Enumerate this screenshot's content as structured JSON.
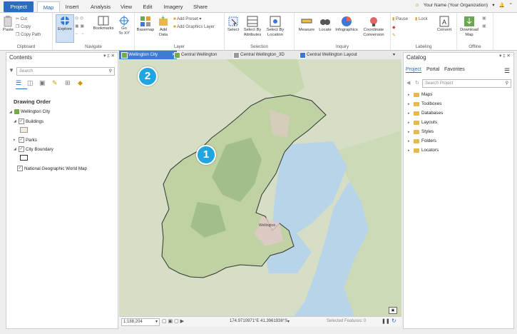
{
  "ribbon_tabs": [
    "Project",
    "Map",
    "Insert",
    "Analysis",
    "View",
    "Edit",
    "Imagery",
    "Share"
  ],
  "user": {
    "name": "Your Name (Your Organization)"
  },
  "clipboard": {
    "paste": "Paste",
    "cut": "Cut",
    "copy": "Copy",
    "copy_path": "Copy Path",
    "label": "Clipboard"
  },
  "navigate": {
    "explore": "Explore",
    "bookmarks": "Bookmarks",
    "go_to_xy": "Go To XY",
    "go": "Go",
    "to_xy": "To XY",
    "label": "Navigate"
  },
  "layer": {
    "basemap": "Basemap",
    "add_data": "Add",
    "add_data2": "Data",
    "add_preset": "Add Preset",
    "add_graphics": "Add Graphics Layer",
    "label": "Layer"
  },
  "selection": {
    "select": "Select",
    "by_attr1": "Select By",
    "by_attr2": "Attributes",
    "by_loc1": "Select By",
    "by_loc2": "Location",
    "label": "Selection"
  },
  "inquiry": {
    "measure": "Measure",
    "locate": "Locate",
    "infographics": "Infographics",
    "coord1": "Coordinate",
    "coord2": "Conversion",
    "label": "Inquiry"
  },
  "labeling": {
    "pause": "Pause",
    "lock": "Lock",
    "convert": "Convert",
    "label": "Labeling"
  },
  "offline": {
    "download1": "Download",
    "download2": "Map",
    "label": "Offline"
  },
  "contents": {
    "title": "Contents",
    "search_placeholder": "Search",
    "drawing_order": "Drawing Order",
    "layers": [
      "Wellington City",
      "Buildings",
      "Parks",
      "City Boundary",
      "National Geographic World Map"
    ]
  },
  "map_tabs": [
    "Wellington City",
    "Central Wellington",
    "Central Wellington_3D",
    "Central Wellington Layout"
  ],
  "callouts": [
    "1",
    "2"
  ],
  "map_labels": {
    "label1": "Wellington"
  },
  "status": {
    "scale": "1:188,204",
    "coords": "174.9710971°E 41.3961938°S",
    "selected": "Selected Features: 0"
  },
  "catalog": {
    "title": "Catalog",
    "tabs": [
      "Project",
      "Portal",
      "Favorites"
    ],
    "search_placeholder": "Search Project",
    "items": [
      "Maps",
      "Toolboxes",
      "Databases",
      "Layouts",
      "Styles",
      "Folders",
      "Locators"
    ]
  },
  "colors": {
    "accent": "#2b6cc4",
    "active_tab": "#3b7bd1",
    "callout": "#1fa6e0",
    "water": "#b8d4e8",
    "land": "#c9d9b0"
  }
}
